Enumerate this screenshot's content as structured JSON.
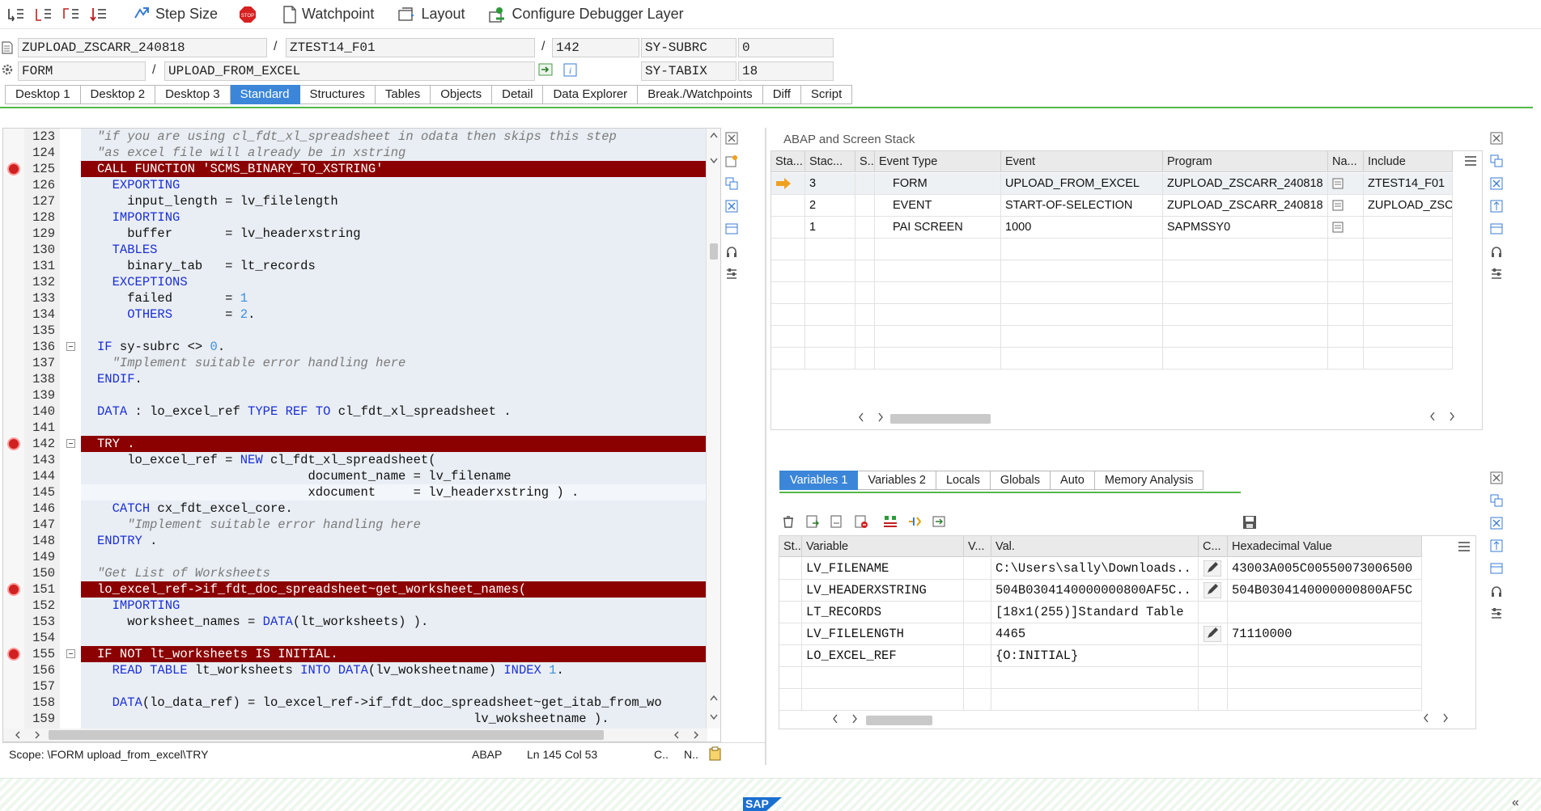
{
  "toolbar": {
    "step_size": "Step Size",
    "watchpoint": "Watchpoint",
    "layout": "Layout",
    "configure": "Configure Debugger Layer"
  },
  "program": {
    "main_program": "ZUPLOAD_ZSCARR_240818",
    "include": "ZTEST14_F01",
    "line": "142",
    "sy_subrc_label": "SY-SUBRC",
    "sy_subrc_value": "0",
    "event_type": "FORM",
    "event_name": "UPLOAD_FROM_EXCEL",
    "sy_tabix_label": "SY-TABIX",
    "sy_tabix_value": "18",
    "separator": "/"
  },
  "desktop_tabs": [
    "Desktop 1",
    "Desktop 2",
    "Desktop 3",
    "Standard",
    "Structures",
    "Tables",
    "Objects",
    "Detail",
    "Data Explorer",
    "Break./Watchpoints",
    "Diff",
    "Script"
  ],
  "editor": {
    "lines": [
      {
        "n": "123",
        "t": "  \"if you are using cl_fdt_xl_spreadsheet in odata then skips this step"
      },
      {
        "n": "124",
        "t": "  \"as excel file will already be in xstring"
      },
      {
        "n": "125",
        "t": "  CALL FUNCTION 'SCMS_BINARY_TO_XSTRING'"
      },
      {
        "n": "126",
        "t": "    EXPORTING"
      },
      {
        "n": "127",
        "t": "      input_length = lv_filelength"
      },
      {
        "n": "128",
        "t": "    IMPORTING"
      },
      {
        "n": "129",
        "t": "      buffer       = lv_headerxstring"
      },
      {
        "n": "130",
        "t": "    TABLES"
      },
      {
        "n": "131",
        "t": "      binary_tab   = lt_records"
      },
      {
        "n": "132",
        "t": "    EXCEPTIONS"
      },
      {
        "n": "133",
        "t": "      failed       = 1"
      },
      {
        "n": "134",
        "t": "      OTHERS       = 2."
      },
      {
        "n": "135",
        "t": ""
      },
      {
        "n": "136",
        "t": "  IF sy-subrc <> 0."
      },
      {
        "n": "137",
        "t": "    \"Implement suitable error handling here"
      },
      {
        "n": "138",
        "t": "  ENDIF."
      },
      {
        "n": "139",
        "t": ""
      },
      {
        "n": "140",
        "t": "  DATA : lo_excel_ref TYPE REF TO cl_fdt_xl_spreadsheet ."
      },
      {
        "n": "141",
        "t": ""
      },
      {
        "n": "142",
        "t": "  TRY ."
      },
      {
        "n": "143",
        "t": "      lo_excel_ref = NEW cl_fdt_xl_spreadsheet("
      },
      {
        "n": "144",
        "t": "                              document_name = lv_filename"
      },
      {
        "n": "145",
        "t": "                              xdocument     = lv_headerxstring ) ."
      },
      {
        "n": "146",
        "t": "    CATCH cx_fdt_excel_core."
      },
      {
        "n": "147",
        "t": "      \"Implement suitable error handling here"
      },
      {
        "n": "148",
        "t": "  ENDTRY ."
      },
      {
        "n": "149",
        "t": ""
      },
      {
        "n": "150",
        "t": "  \"Get List of Worksheets"
      },
      {
        "n": "151",
        "t": "  lo_excel_ref->if_fdt_doc_spreadsheet~get_worksheet_names("
      },
      {
        "n": "152",
        "t": "    IMPORTING"
      },
      {
        "n": "153",
        "t": "      worksheet_names = DATA(lt_worksheets) )."
      },
      {
        "n": "154",
        "t": ""
      },
      {
        "n": "155",
        "t": "  IF NOT lt_worksheets IS INITIAL."
      },
      {
        "n": "156",
        "t": "    READ TABLE lt_worksheets INTO DATA(lv_woksheetname) INDEX 1."
      },
      {
        "n": "157",
        "t": ""
      },
      {
        "n": "158",
        "t": "    DATA(lo_data_ref) = lo_excel_ref->if_fdt_doc_spreadsheet~get_itab_from_wo"
      },
      {
        "n": "159",
        "t": "                                                    lv_woksheetname )."
      }
    ]
  },
  "status": {
    "scope": "Scope: \\FORM upload_from_excel\\TRY",
    "lang": "ABAP",
    "position": "Ln 145 Col  53",
    "c": "C..",
    "n": "N.."
  },
  "stack": {
    "title": "ABAP and Screen Stack",
    "headers": [
      "Sta...",
      "Stac...",
      "S..",
      "Event Type",
      "Event",
      "Program",
      "Na...",
      "Include"
    ],
    "rows": [
      {
        "level": "3",
        "type": "FORM",
        "event": "UPLOAD_FROM_EXCEL",
        "program": "ZUPLOAD_ZSCARR_240818",
        "include": "ZTEST14_F01"
      },
      {
        "level": "2",
        "type": "EVENT",
        "event": "START-OF-SELECTION",
        "program": "ZUPLOAD_ZSCARR_240818",
        "include": "ZUPLOAD_ZSCAR"
      },
      {
        "level": "1",
        "type": "PAI SCREEN",
        "event": "1000",
        "program": "SAPMSSY0",
        "include": ""
      }
    ]
  },
  "var_tabs": [
    "Variables 1",
    "Variables 2",
    "Locals",
    "Globals",
    "Auto",
    "Memory Analysis"
  ],
  "variables": {
    "headers": [
      "St...",
      "Variable",
      "V...",
      "Val.",
      "C...",
      "Hexadecimal Value"
    ],
    "rows": [
      {
        "name": "LV_FILENAME",
        "value": "C:\\Users\\sally\\Downloads..",
        "hex": "43003A005C00550073006500"
      },
      {
        "name": "LV_HEADERXSTRING",
        "value": "504B0304140000000800AF5C..",
        "hex": "504B0304140000000800AF5C"
      },
      {
        "name": "LT_RECORDS",
        "value": "[18x1(255)]Standard Table",
        "hex": ""
      },
      {
        "name": "LV_FILELENGTH",
        "value": "4465",
        "hex": "71110000"
      },
      {
        "name": "LO_EXCEL_REF",
        "value": "{O:INITIAL}",
        "hex": ""
      }
    ]
  },
  "footer": {
    "logo": "SAP",
    "collapse": "«"
  },
  "colors": {
    "breakpoint_line": "#8b0000",
    "active_tab": "#3b86d8",
    "accent_line": "#54b848"
  }
}
